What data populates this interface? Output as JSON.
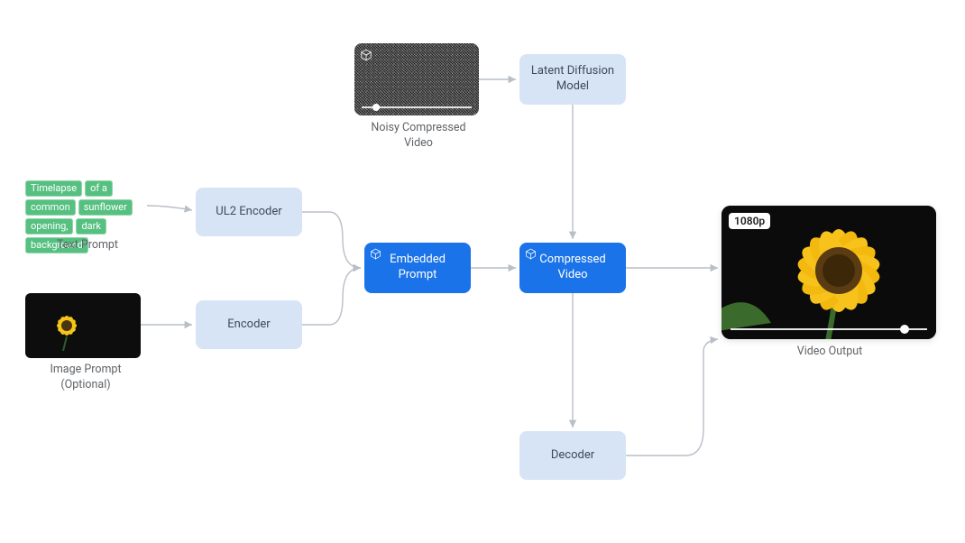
{
  "text_prompt": {
    "tokens": [
      "Timelapse",
      "of a",
      "common",
      "sunflower",
      "opening,",
      "dark",
      "background"
    ],
    "caption": "Text Prompt"
  },
  "image_prompt": {
    "caption": "Image Prompt\n(Optional)"
  },
  "noisy_video": {
    "caption": "Noisy Compressed\nVideo"
  },
  "nodes": {
    "ul2_encoder": "UL2 Encoder",
    "encoder": "Encoder",
    "embedded_prompt": "Embedded\nPrompt",
    "latent_diffusion": "Latent Diffusion\nModel",
    "compressed_video": "Compressed\nVideo",
    "decoder": "Decoder"
  },
  "video_output": {
    "resolution_badge": "1080p",
    "caption": "Video Output"
  }
}
